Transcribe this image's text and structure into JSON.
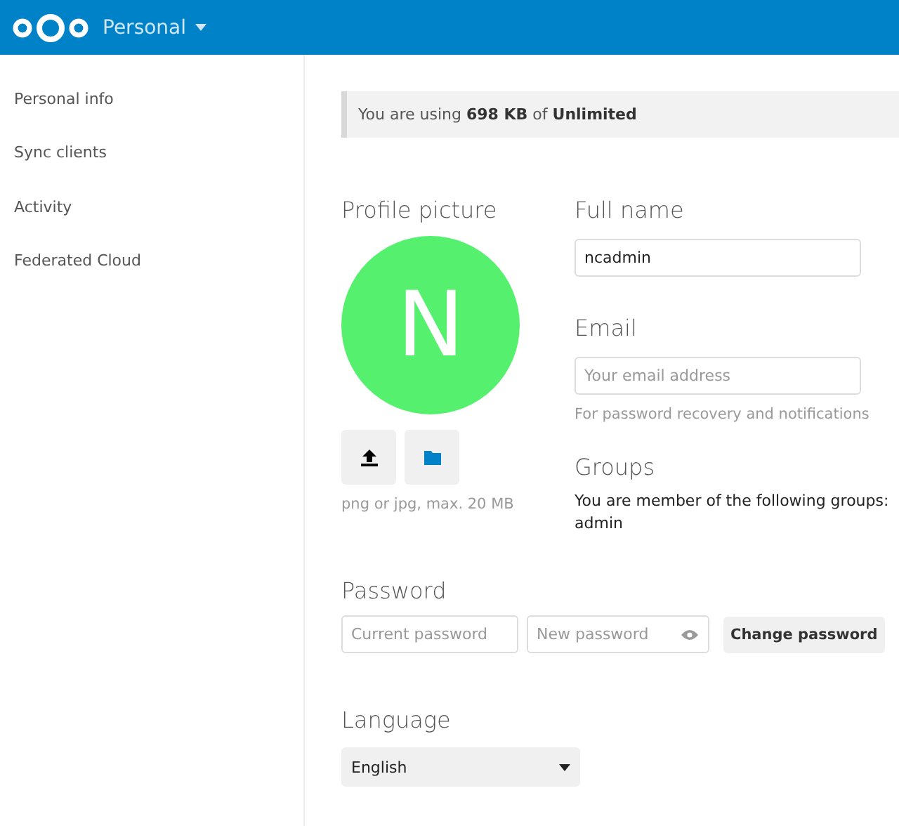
{
  "header": {
    "app_menu": "Personal"
  },
  "sidebar": {
    "items": [
      {
        "label": "Personal info",
        "selected": false
      },
      {
        "label": "Sync clients",
        "selected": false
      },
      {
        "label": "Activity",
        "selected": false
      },
      {
        "label": "Federated Cloud",
        "selected": false
      }
    ]
  },
  "quota": {
    "text": "You are using **698 KB** of **Unlimited**"
  },
  "profile_picture": {
    "title": "Profile picture",
    "initial": "N",
    "color": "#55f06d",
    "hint": "png or jpg, max. 20 MB"
  },
  "full_name": {
    "title": "Full name",
    "value": "ncadmin"
  },
  "email": {
    "title": "Email",
    "placeholder": "Your email address",
    "hint": "For password recovery and notifications"
  },
  "groups": {
    "title": "Groups",
    "text": "You are member of the following groups:",
    "list": "admin"
  },
  "password": {
    "title": "Password",
    "current_placeholder": "Current password",
    "new_placeholder": "New password",
    "button": "Change password"
  },
  "language": {
    "title": "Language",
    "value": "English"
  }
}
